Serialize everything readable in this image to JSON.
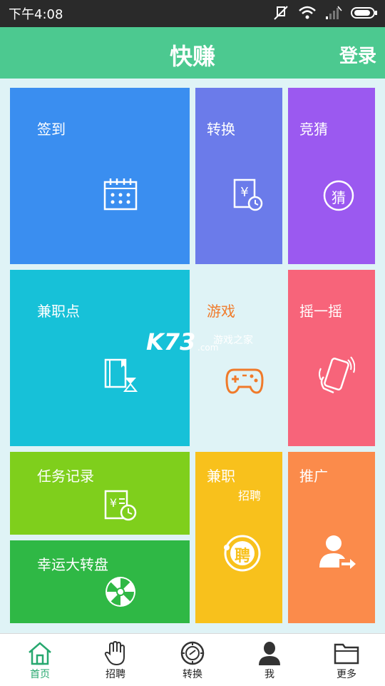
{
  "status_bar": {
    "time": "下午4:08"
  },
  "header": {
    "title": "快赚",
    "login_label": "登录"
  },
  "tiles": {
    "checkin": {
      "label": "签到",
      "color": "#3a8ef0"
    },
    "convert": {
      "label": "转换",
      "color": "#6b7bea"
    },
    "guess": {
      "label": "竞猜",
      "color": "#9b59f0",
      "icon_text": "猜"
    },
    "parttime_points": {
      "label": "兼职点",
      "color": "#17c1d8"
    },
    "game": {
      "label": "游戏",
      "color": "#f07a2a"
    },
    "shake": {
      "label": "摇一摇",
      "color": "#f7647a"
    },
    "task_record": {
      "label": "任务记录",
      "color": "#7fcf1c"
    },
    "lucky_wheel": {
      "label": "幸运大转盘",
      "color": "#2fb845"
    },
    "parttime": {
      "label": "兼职",
      "sublabel": "招聘",
      "color": "#f8c11c",
      "icon_text": "聘"
    },
    "promote": {
      "label": "推广",
      "color": "#fb8b4b"
    }
  },
  "watermark": {
    "main": "K73",
    "sub": "游戏之家",
    "domain": ".com"
  },
  "bottom_nav": [
    {
      "label": "首页",
      "icon": "home-icon",
      "active": true
    },
    {
      "label": "招聘",
      "icon": "hand-icon"
    },
    {
      "label": "转换",
      "icon": "exchange-icon"
    },
    {
      "label": "我",
      "icon": "person-icon"
    },
    {
      "label": "更多",
      "icon": "folder-icon"
    }
  ],
  "colors": {
    "header": "#4cc990",
    "accent": "#27a86f",
    "status_bar": "#2a2a2a"
  }
}
